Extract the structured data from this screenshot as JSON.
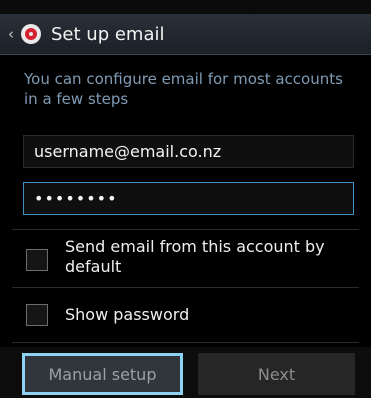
{
  "header": {
    "title": "Set up email",
    "back_icon": "chevron-left-icon",
    "app_icon": "email-app-icon"
  },
  "intro_text": "You can configure email for most accounts in a few steps",
  "form": {
    "email_value": "username@email.co.nz",
    "password_value": "••••••••"
  },
  "options": {
    "send_default_label": "Send email from this account by default",
    "send_default_checked": false,
    "show_password_label": "Show password",
    "show_password_checked": false
  },
  "buttons": {
    "manual_setup": "Manual setup",
    "next": "Next"
  },
  "colors": {
    "accent": "#3f8fc1",
    "focus_ring": "#8bd3f0",
    "intro_text": "#7f9bb4",
    "app_icon_red": "#d6212f"
  }
}
